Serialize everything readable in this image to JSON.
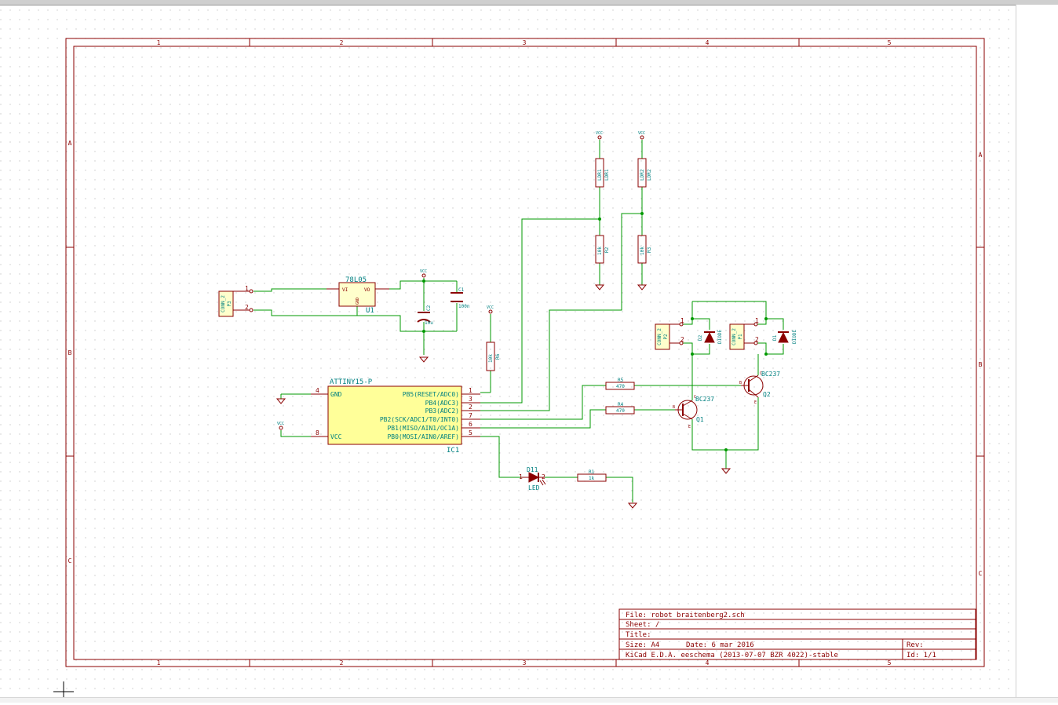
{
  "colors": {
    "frame": "#8b0000",
    "wire": "#009900",
    "component": "#8b0000",
    "label": "#008080",
    "ic_fill": "#ffff99",
    "grid": "#c8c8c8"
  },
  "frame": {
    "columns": [
      "1",
      "2",
      "3",
      "4",
      "5"
    ],
    "rows": [
      "A",
      "B",
      "C"
    ]
  },
  "title_block": {
    "file": "File: robot braitenberg2.sch",
    "sheet": "Sheet: /",
    "title": "Title:",
    "size": "Size: A4",
    "date": "Date: 6 mar 2016",
    "rev": "Rev:",
    "tool": "KiCad E.D.A.  eeschema (2013-07-07 BZR 4022)-stable",
    "id": "Id: 1/1"
  },
  "components": {
    "regulator": {
      "value": "78L05",
      "ref": "U1",
      "pin_vi": "VI",
      "pin_vo": "VO",
      "pin_gnd": "GND"
    },
    "conn_p3": {
      "value": "CONN_2",
      "ref": "P3",
      "pin1": "1",
      "pin2": "2"
    },
    "c1": {
      "ref": "C1",
      "value": "100n"
    },
    "c2": {
      "ref": "C2",
      "value": "10u"
    },
    "r6": {
      "ref": "R6",
      "value": "10k"
    },
    "ic1": {
      "value": "ATTINY15-P",
      "ref": "IC1",
      "pin_gnd": "GND",
      "pin_vcc": "VCC",
      "pin_gnd_num": "4",
      "pin_vcc_num": "8",
      "pins_right": [
        {
          "name": "PB5(RESET/ADC0)",
          "num": "1"
        },
        {
          "name": "PB4(ADC3)",
          "num": "3"
        },
        {
          "name": "PB3(ADC2)",
          "num": "2"
        },
        {
          "name": "PB2(SCK/ADC1/T0/INT0)",
          "num": "7"
        },
        {
          "name": "PB1(MISO/AIN1/OC1A)",
          "num": "6"
        },
        {
          "name": "PB0(MOSI/AIN0/AREF)",
          "num": "5"
        }
      ]
    },
    "ldr1": {
      "ref": "LDR1",
      "value": "LDR1"
    },
    "ldr2": {
      "ref": "LDR2",
      "value": "LDR2"
    },
    "r2": {
      "ref": "R2",
      "value": "10k"
    },
    "r3": {
      "ref": "R3",
      "value": "10k"
    },
    "p2": {
      "value": "CONN_2",
      "ref": "P2",
      "pin1": "1",
      "pin2": "2"
    },
    "p1": {
      "value": "CONN_2",
      "ref": "P1",
      "pin1": "1",
      "pin2": "2"
    },
    "d2": {
      "ref": "D2",
      "value": "DIODE"
    },
    "d1": {
      "ref": "D1",
      "value": "DIODE"
    },
    "r5": {
      "ref": "R5",
      "value": "470"
    },
    "r4": {
      "ref": "R4",
      "value": "470"
    },
    "q1": {
      "value": "BC237",
      "ref": "Q1",
      "pin_b": "B",
      "pin_c": "C",
      "pin_e": "E"
    },
    "q2": {
      "value": "BC237",
      "ref": "Q2",
      "pin_b": "B",
      "pin_c": "C",
      "pin_e": "E"
    },
    "d11": {
      "ref": "D11",
      "value": "LED",
      "pin1": "1",
      "pin2": "2"
    },
    "r1": {
      "ref": "R1",
      "value": "1k"
    }
  },
  "power_labels": {
    "vcc": "VCC"
  }
}
